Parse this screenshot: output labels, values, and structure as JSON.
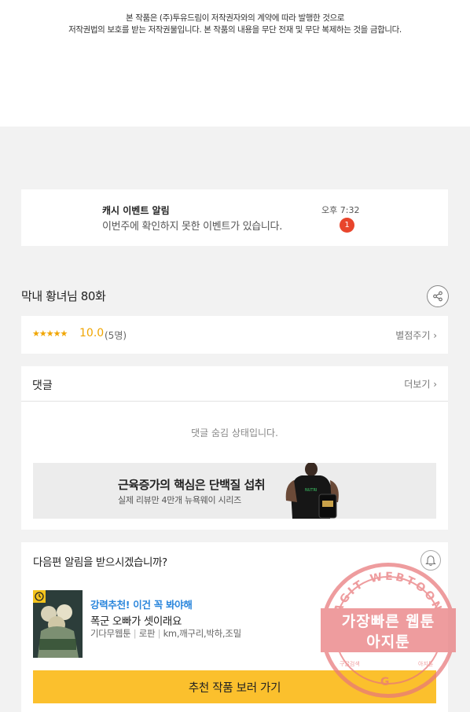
{
  "copyright": {
    "line1": "본 작품은 (주)투유드림이 저작권자와의 계약에 따라 발행한 것으로",
    "line2": "저작권법의 보호를 받는 저작권물입니다. 본 작품의 내용을 무단 전재 및 무단 복제하는 것을 금합니다."
  },
  "notification": {
    "title": "캐시 이벤트 알림",
    "message": "이번주에 확인하지 못한 이벤트가 있습니다.",
    "time": "오후 7:32",
    "badge": "1"
  },
  "episode": {
    "title": "막내 황녀님 80화",
    "share_icon": "share-icon"
  },
  "rating": {
    "stars": "★★★★★",
    "score": "10.0",
    "count": "(5명)",
    "rate_label": "별점주기 ›"
  },
  "comments": {
    "header": "댓글",
    "more_label": "더보기 ›",
    "hidden_message": "댓글 숨김 상태입니다."
  },
  "ad": {
    "title": "근육증가의 핵심은 단백질 섭취",
    "subtitle": "실제 리뷰만 4만개 뉴욕웨이 시리즈"
  },
  "next_episode": {
    "question": "다음편 알림을 받으시겠습니까?",
    "bell_icon": "bell-icon",
    "recommend_tag": "강력추천! 이건 꼭 봐야해",
    "recommend_title": "폭군 오빠가 셋이래요",
    "meta_author": "기다무웹툰",
    "meta_genre": "로판",
    "meta_creators": "km,깨구리,박하,조밀",
    "cta": "추천 작품 보러 가기"
  },
  "watermark": {
    "arc_text": "AGIT WEBTOON",
    "line1": "가장빠른 웹툰",
    "line2": "아지툰",
    "small_left": "구글검색",
    "small_right": "아지툰",
    "g": "G"
  },
  "colors": {
    "accent_yellow": "#fbc02d",
    "star_orange": "#f0a500",
    "badge_red": "#e8452c",
    "tag_blue": "#2a86dc",
    "watermark": "#e8777a"
  }
}
